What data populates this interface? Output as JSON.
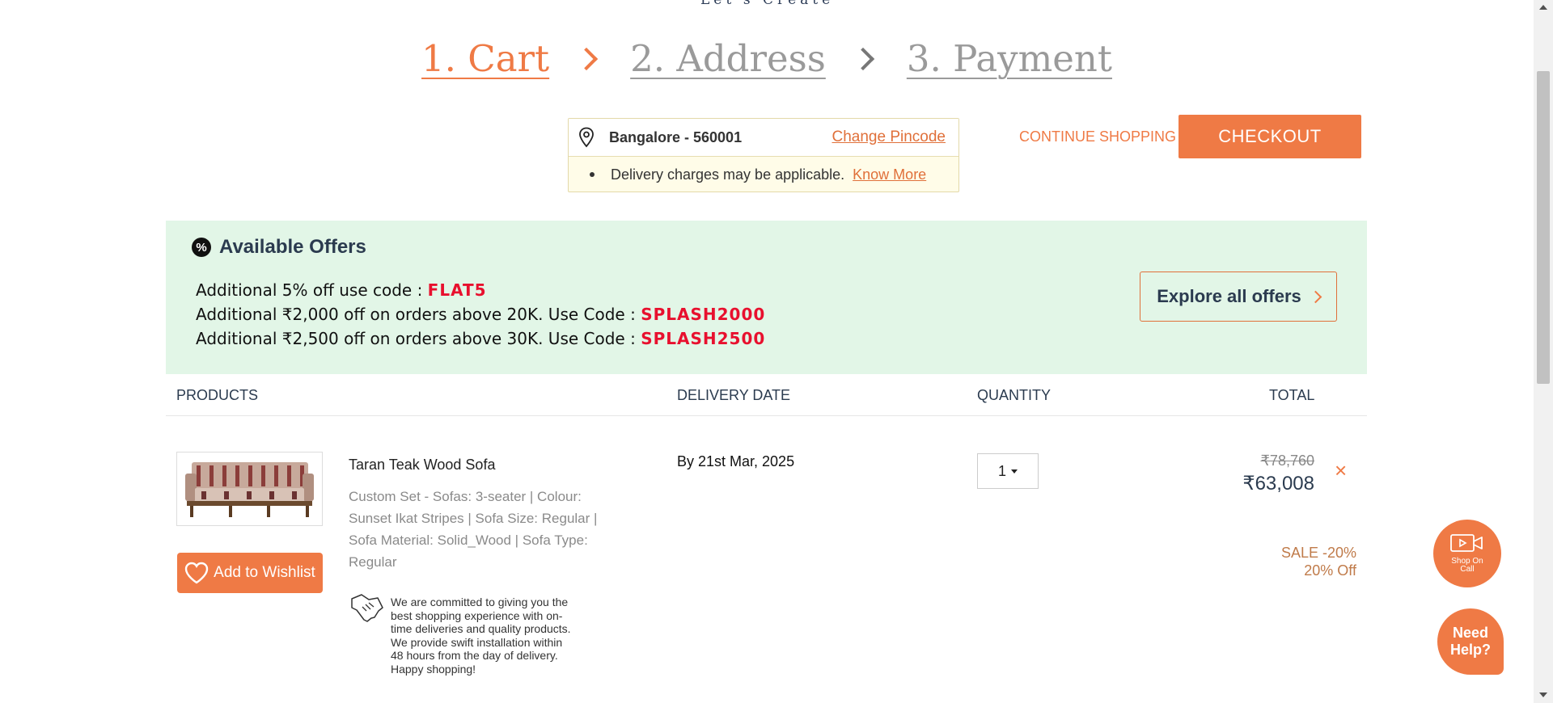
{
  "header": {
    "logo_tagline": "Let's Create"
  },
  "steps": [
    {
      "label": "1. Cart",
      "active": true
    },
    {
      "label": "2. Address",
      "active": false
    },
    {
      "label": "3. Payment",
      "active": false
    }
  ],
  "pincode": {
    "location": "Bangalore - 560001",
    "change_label": "Change Pincode",
    "note": "Delivery charges may be applicable.",
    "know_more": "Know More"
  },
  "actions": {
    "continue_label": "CONTINUE SHOPPING",
    "checkout_label": "CHECKOUT"
  },
  "offers": {
    "title": "Available Offers",
    "badge_icon": "%",
    "items": [
      {
        "text": "Additional 5% off use code : ",
        "code": "FLAT5"
      },
      {
        "text": "Additional ₹2,000 off on orders above 20K. Use Code : ",
        "code": "SPLASH2000"
      },
      {
        "text": "Additional ₹2,500 off on orders above 30K. Use Code : ",
        "code": "SPLASH2500"
      }
    ],
    "explore_label": "Explore all offers"
  },
  "table": {
    "headers": [
      "PRODUCTS",
      "DELIVERY DATE",
      "QUANTITY",
      "TOTAL"
    ]
  },
  "product": {
    "name": "Taran Teak Wood Sofa",
    "description": "Custom Set - Sofas: 3-seater | Colour: Sunset Ikat Stripes | Sofa Size: Regular | Sofa Material: Solid_Wood | Sofa Type: Regular",
    "wishlist_label": "Add to Wishlist",
    "commitment": "We are committed to giving you the best shopping experience with on-time deliveries and quality products. We provide swift installation within 48 hours from the day of delivery. Happy shopping!",
    "delivery": "By 21st Mar, 2025",
    "quantity": "1",
    "old_price": "₹78,760",
    "new_price": "₹63,008",
    "remove_icon": "×",
    "sale_label": "SALE -20%",
    "off_label": "20% Off"
  },
  "floating": {
    "shop_on_call": "Shop On Call",
    "need_help": "Need Help?"
  },
  "colors": {
    "accent": "#ef7a45",
    "offer_bg": "#e2f6e7",
    "code_red": "#e8102e",
    "navy": "#2b3b4f"
  }
}
